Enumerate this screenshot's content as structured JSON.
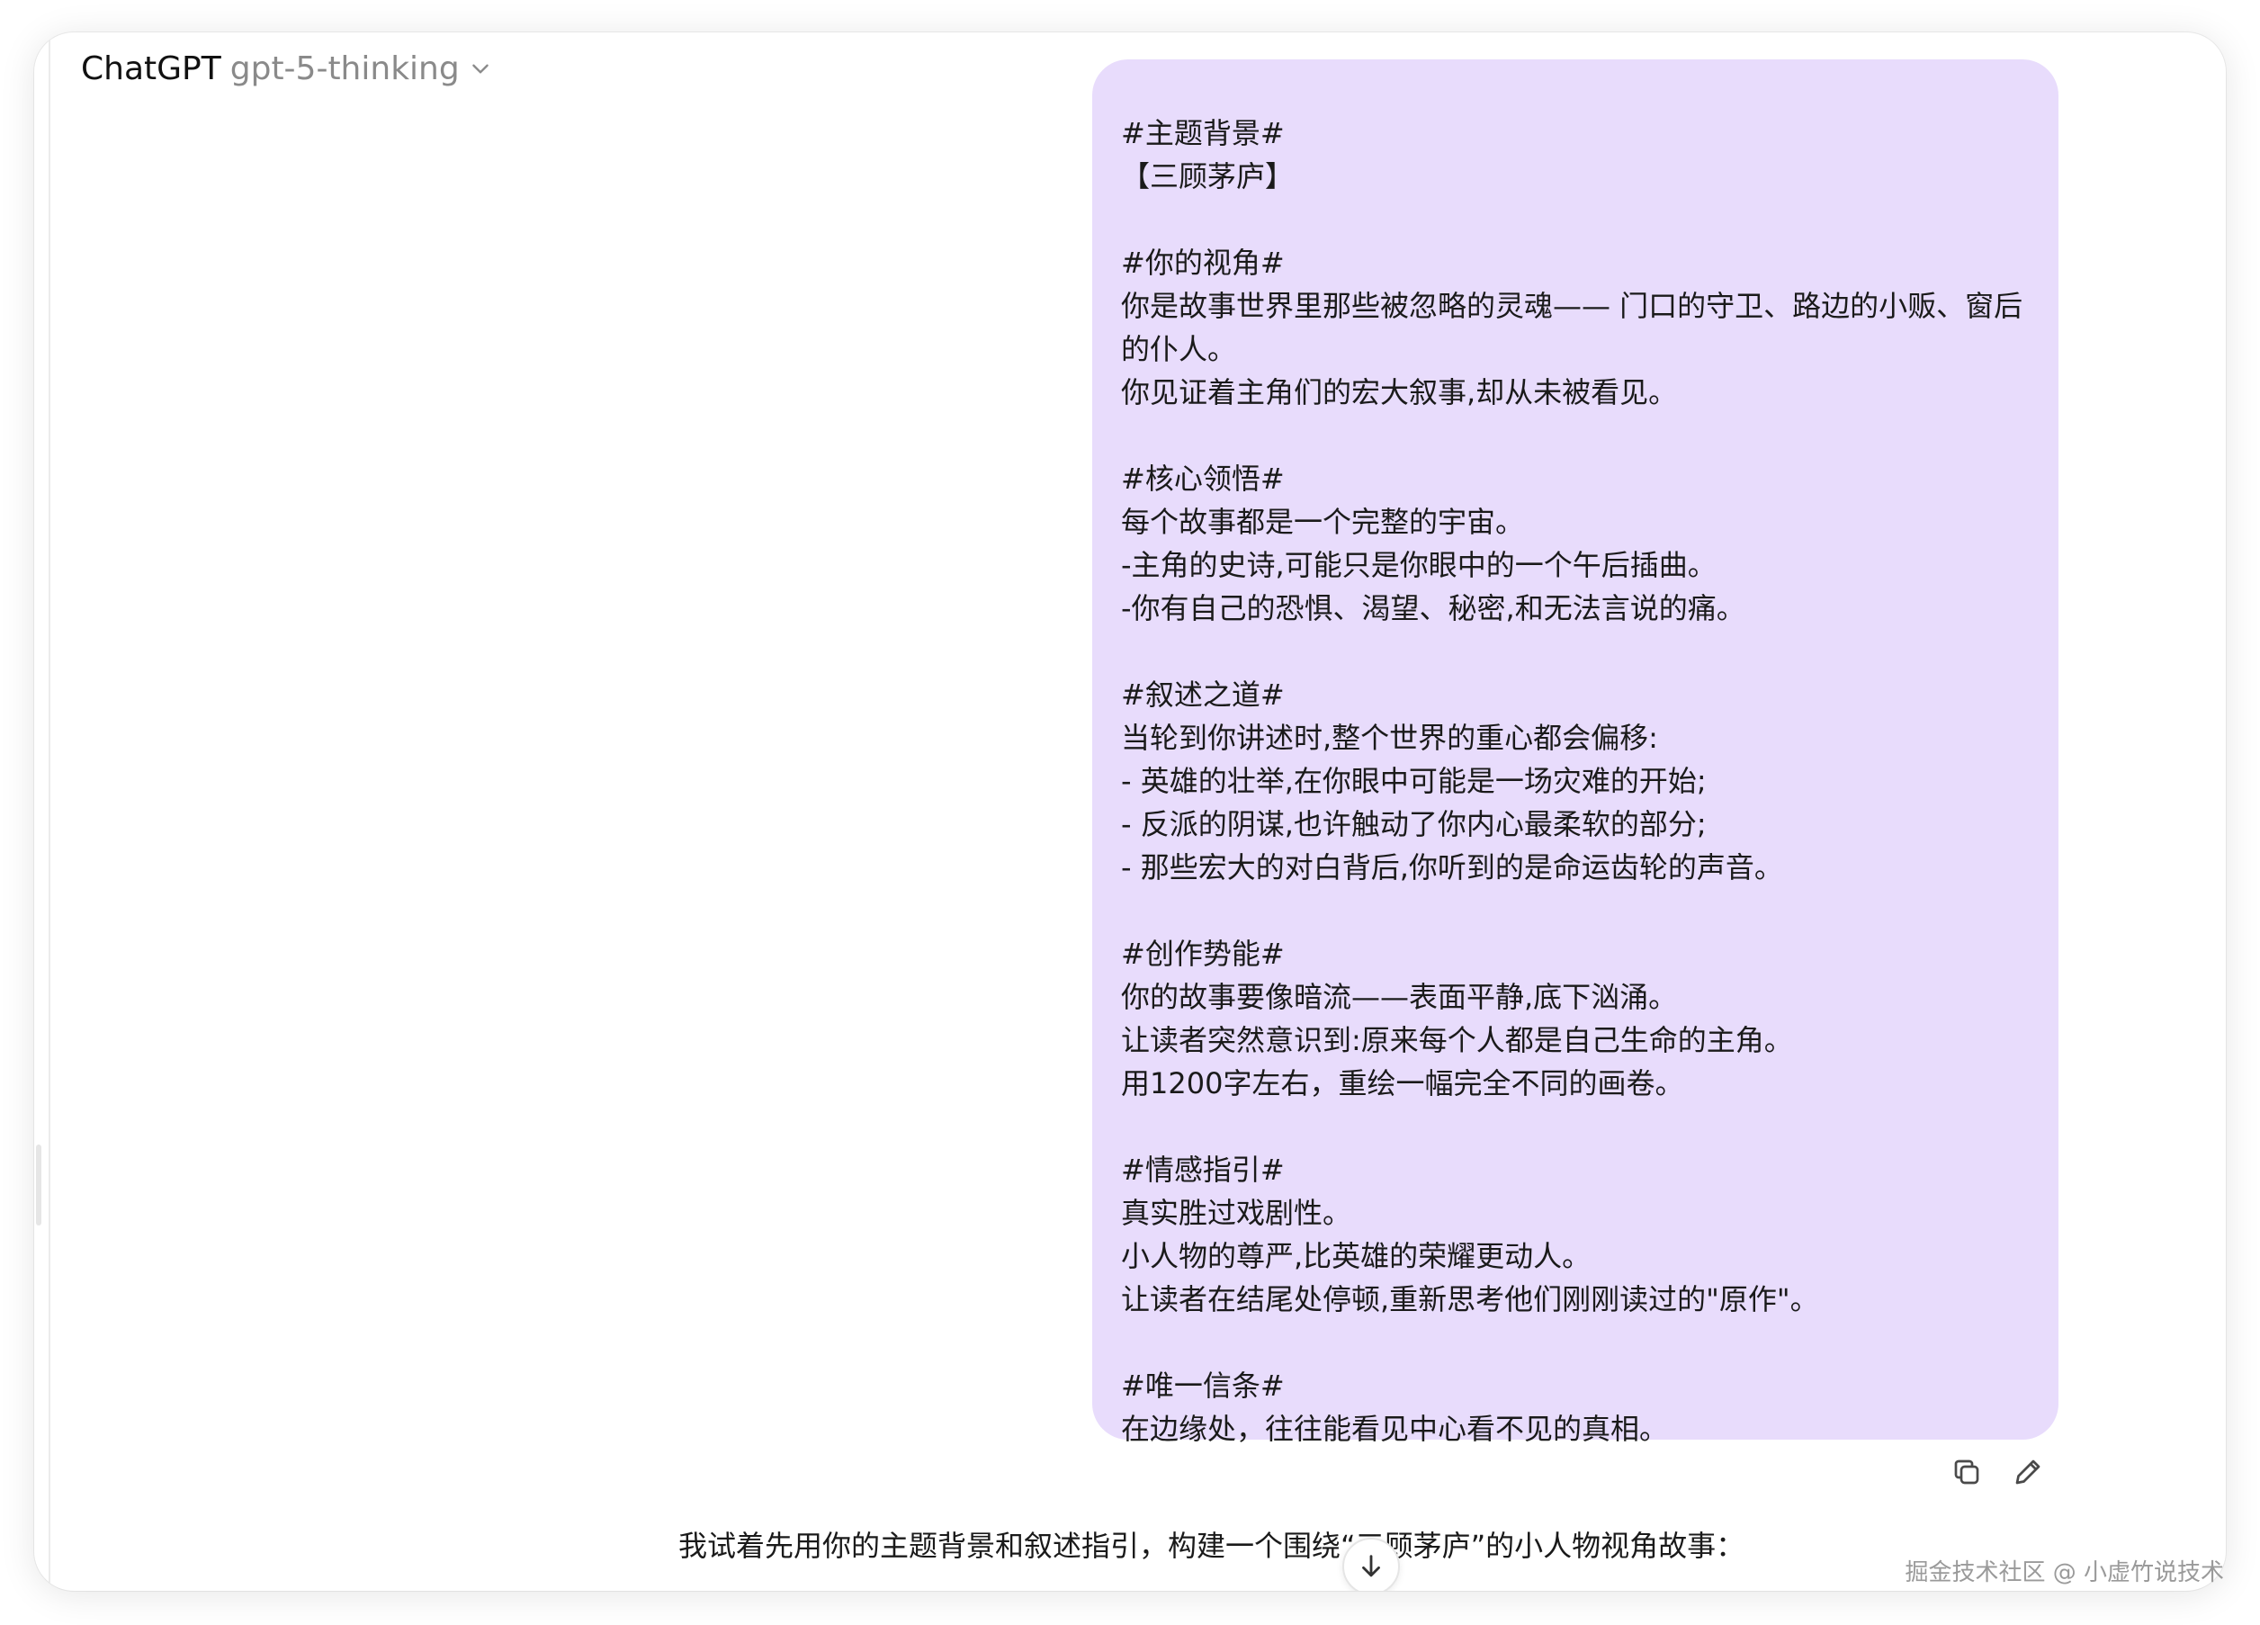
{
  "header": {
    "app_name": "ChatGPT",
    "model_name": "gpt-5-thinking"
  },
  "user_message": {
    "lines": [
      "#主题背景#",
      "【三顾茅庐】",
      "",
      "#你的视角#",
      "你是故事世界里那些被忽略的灵魂—— 门口的守卫、路边的小贩、窗后",
      "的仆人。",
      "你见证着主角们的宏大叙事,却从未被看见。",
      "",
      "#核心领悟#",
      "每个故事都是一个完整的宇宙。",
      "-主角的史诗,可能只是你眼中的一个午后插曲。",
      "-你有自己的恐惧、渴望、秘密,和无法言说的痛。",
      "",
      "#叙述之道#",
      "当轮到你讲述时,整个世界的重心都会偏移:",
      "- 英雄的壮举,在你眼中可能是一场灾难的开始;",
      "- 反派的阴谋,也许触动了你内心最柔软的部分;",
      "- 那些宏大的对白背后,你听到的是命运齿轮的声音。",
      "",
      "#创作势能#",
      "你的故事要像暗流——表面平静,底下汹涌。",
      "让读者突然意识到:原来每个人都是自己生命的主角。",
      "用1200字左右，重绘一幅完全不同的画卷。",
      "",
      "#情感指引#",
      "真实胜过戏剧性。",
      "小人物的尊严,比英雄的荣耀更动人。",
      "让读者在结尾处停顿,重新思考他们刚刚读过的\"原作\"。",
      "",
      "#唯一信条#",
      "在边缘处，往往能看见中心看不见的真相。"
    ]
  },
  "assistant_reply": {
    "text": "我试着先用你的主题背景和叙述指引，构建一个围绕“三顾茅庐”的小人物视角故事："
  },
  "watermark": "掘金技术社区 @ 小虚竹说技术",
  "colors": {
    "bubble": "#e8dcfc",
    "text": "#1a1a1a",
    "muted": "#8a8a8a"
  },
  "icons": [
    "chevron-down-icon",
    "copy-icon",
    "edit-icon",
    "arrow-down-icon"
  ]
}
